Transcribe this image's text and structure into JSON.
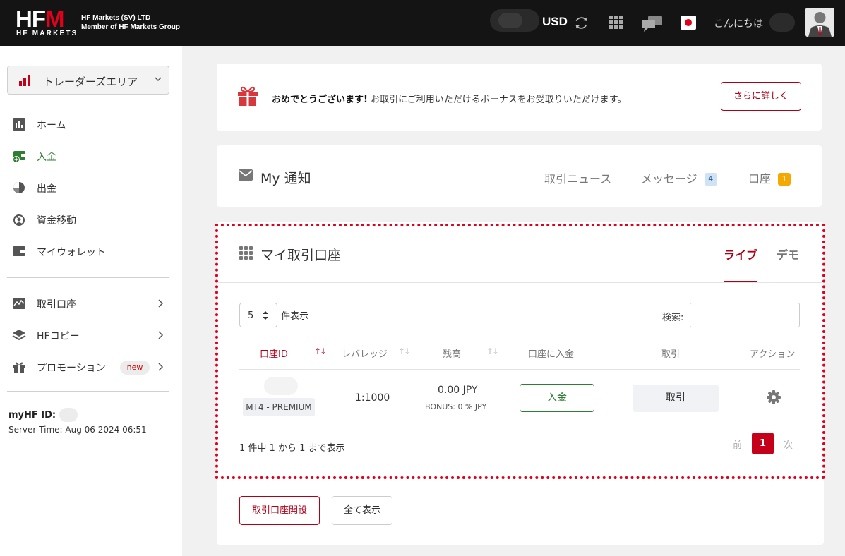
{
  "brand": {
    "logo_main_a": "HF",
    "logo_main_b": "M",
    "logo_sub": "HF MARKETS",
    "company_line1": "HF Markets (SV) LTD",
    "company_line2": "Member of HF Markets Group"
  },
  "header": {
    "currency": "USD",
    "greeting": "こんにちは",
    "icons": [
      "refresh-icon",
      "apps-grid-icon",
      "chat-icon",
      "japan-flag-icon",
      "avatar"
    ]
  },
  "sidebar": {
    "area_select": "トレーダーズエリア",
    "items": [
      {
        "label": "ホーム",
        "icon": "dashboard-icon"
      },
      {
        "label": "入金",
        "icon": "deposit-icon"
      },
      {
        "label": "出金",
        "icon": "withdraw-icon"
      },
      {
        "label": "資金移動",
        "icon": "transfer-icon"
      },
      {
        "label": "マイウォレット",
        "icon": "wallet-icon"
      }
    ],
    "items2": [
      {
        "label": "取引口座",
        "icon": "chart-icon"
      },
      {
        "label": "HFコピー",
        "icon": "layers-icon"
      },
      {
        "label": "プロモーション",
        "icon": "gift-icon",
        "badge": "new"
      }
    ],
    "myhf_label": "myHF ID:",
    "server_time": "Server Time: Aug 06 2024 06:51"
  },
  "bonus": {
    "bold": "おめでとうございます!",
    "text": " お取引にご利用いただけるボーナスをお受取りいただけます。",
    "button": "さらに詳しく"
  },
  "notifications": {
    "title": "My 通知",
    "tabs": [
      {
        "label": "取引ニュース"
      },
      {
        "label": "メッセージ",
        "count": "4"
      },
      {
        "label": "口座",
        "count": "1"
      }
    ]
  },
  "accounts": {
    "title": "マイ取引口座",
    "tab_live": "ライブ",
    "tab_demo": "デモ",
    "per_page_value": "5",
    "per_page_label": "件表示",
    "search_label": "検索:",
    "columns": [
      "口座ID",
      "レバレッジ",
      "残高",
      "口座に入金",
      "取引",
      "アクション"
    ],
    "sort_icon_active": "↑↓",
    "sort_icon": "↑↓",
    "row": {
      "account_type": "MT4 - PREMIUM",
      "leverage": "1:1000",
      "balance": "0.00 JPY",
      "bonus": "BONUS: 0 % JPY",
      "deposit_button": "入金",
      "trade_button": "取引"
    },
    "info": "1 件中 1 から 1 まで表示",
    "pagination": {
      "prev": "前",
      "current": "1",
      "next": "次"
    },
    "open_account_button": "取引口座開設",
    "show_all_button": "全て表示"
  }
}
